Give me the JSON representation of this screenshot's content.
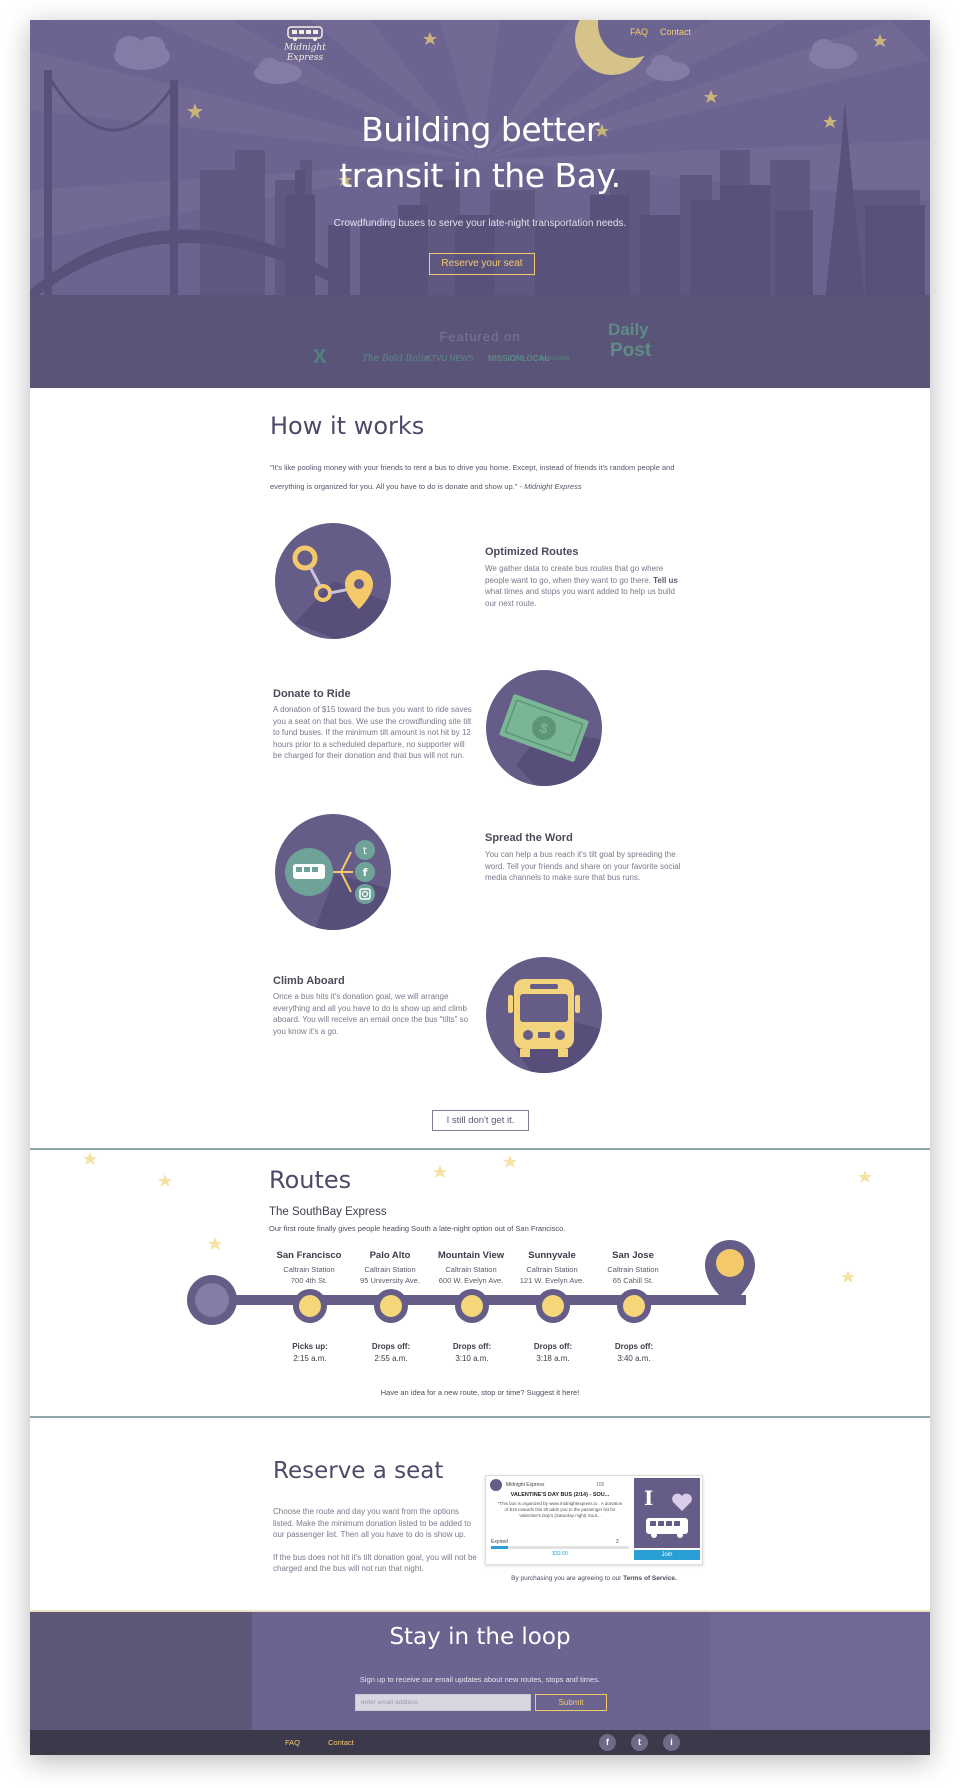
{
  "header": {
    "logo_text": "Midnight Express",
    "nav": [
      "FAQ",
      "Contact"
    ]
  },
  "hero": {
    "title_line1": "Building better",
    "title_line2": "transit in the Bay.",
    "subtitle": "Crowdfunding buses to serve your late-night transportation needs.",
    "cta": "Reserve your seat",
    "featured_label": "Featured on",
    "press": [
      "X",
      "The Bold Italic",
      "KTVU NEWS",
      "MISSIONLOCAL",
      "techcrunch",
      "Daily",
      "Post"
    ]
  },
  "how": {
    "title": "How it works",
    "quote": "\"It's like pooling money with your friends to rent a bus to drive you home. Except, instead of friends it's random people and everything is organized for you. All you have to do is donate and show up.\" - ",
    "quote_author": "Midnight Express",
    "steps": [
      {
        "title": "Optimized Routes",
        "text": "We gather data to create bus routes that go where people want to go, when they want to go there.",
        "link": "Tell us",
        "text2": " what times and stops you want added to help us build our next route."
      },
      {
        "title": "Donate to Ride",
        "text": "A donation of $15 toward the bus you want to ride saves you a seat on that bus. We use the crowdfunding site tilt to fund buses. If the minimum tilt amount is not hit by 12 hours prior to a scheduled departure, no supporter will be charged for their donation and that bus will not run."
      },
      {
        "title": "Spread the Word",
        "text": "You can help a bus reach it's tilt goal by spreading the word. Tell your friends and share on your favorite social media channels to make sure that bus runs."
      },
      {
        "title": "Climb Aboard",
        "text": "Once a bus hits it's donation goal, we will arrange everything and all you have to do is show up and climb aboard. You will receive an email once the bus \"tilts\" so you know it's a go."
      }
    ],
    "button": "I still don't get it."
  },
  "routes": {
    "title": "Routes",
    "route_name": "The SouthBay Express",
    "description": "Our first route finally gives people heading South a late-night option out of San Francisco.",
    "stops": [
      {
        "name": "San Francisco",
        "station": "Caltrain Station",
        "address": "700 4th St.",
        "action": "Picks up:",
        "time": "2:15 a.m."
      },
      {
        "name": "Palo Alto",
        "station": "Caltrain Station",
        "address": "95 University Ave.",
        "action": "Drops off:",
        "time": "2:55 a.m."
      },
      {
        "name": "Mountain View",
        "station": "Caltrain Station",
        "address": "600 W. Evelyn Ave.",
        "action": "Drops off:",
        "time": "3:10 a.m."
      },
      {
        "name": "Sunnyvale",
        "station": "Caltrain Station",
        "address": "121 W. Evelyn Ave.",
        "action": "Drops off:",
        "time": "3:18 a.m."
      },
      {
        "name": "San Jose",
        "station": "Caltrain Station",
        "address": "65 Cahill St.",
        "action": "Drops off:",
        "time": "3:40 a.m."
      }
    ],
    "suggest": "Have an idea for a new route, stop or time? Suggest it here!"
  },
  "reserve": {
    "title": "Reserve a seat",
    "para1": "Choose the route and day you want from the options listed. Make the minimum donation listed to be added to our passenger list. Then all you have to do is show up.",
    "para2": "If the bus does not hit it's tilt donation goal, you will not be charged and the bus will not run that night.",
    "widget": {
      "org": "Midnight Express",
      "count": "105",
      "title": "VALENTINE'S DAY BUS (2/14) - SOU...",
      "body": "\"This bus is organized by www.midnightexpress.io . A donation of $15 towards this tilt adds you to the passenger list for Valentine's Day's (Saturday night) Sout...",
      "status": "Expired",
      "people": "2",
      "amount": "$32.00",
      "join": "Join",
      "badge": "I"
    },
    "agree": "By purchasing you are agreeing to our ",
    "terms": "Terms of Service."
  },
  "loop": {
    "title": "Stay in the loop",
    "subtitle": "Sign up to receive our email updates about new routes, stops and times.",
    "placeholder": "enter email address",
    "submit": "Submit"
  },
  "footer": {
    "links": [
      "FAQ",
      "Contact"
    ],
    "social": [
      "f",
      "t",
      "i"
    ]
  },
  "colors": {
    "purple": "#6c6490",
    "gold": "#f3c969",
    "teal": "#5d8f86"
  }
}
